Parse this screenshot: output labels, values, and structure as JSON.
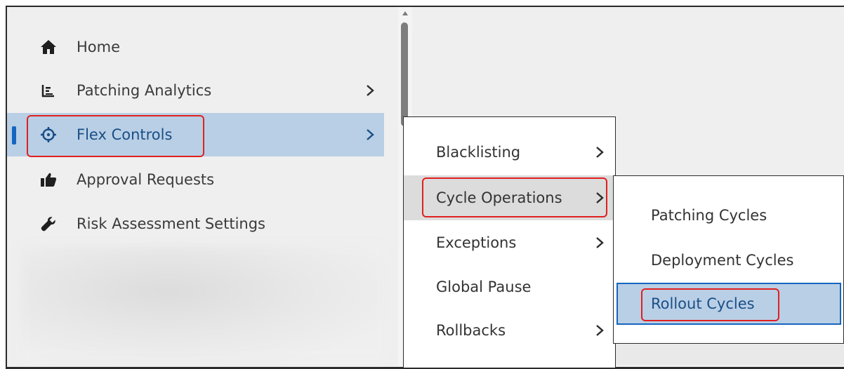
{
  "sidebar": {
    "items": [
      {
        "label": "Home",
        "icon": "home-icon",
        "has_submenu": false
      },
      {
        "label": "Patching Analytics",
        "icon": "analytics-chart-icon",
        "has_submenu": true
      },
      {
        "label": "Flex Controls",
        "icon": "crosshair-icon",
        "has_submenu": true,
        "active": true
      },
      {
        "label": "Approval Requests",
        "icon": "thumbs-up-icon",
        "has_submenu": false
      },
      {
        "label": "Risk Assessment Settings",
        "icon": "wrench-icon",
        "has_submenu": false
      }
    ]
  },
  "flex_submenu": {
    "items": [
      {
        "label": "Blacklisting",
        "has_submenu": true
      },
      {
        "label": "Cycle Operations",
        "has_submenu": true,
        "hovered": true
      },
      {
        "label": "Exceptions",
        "has_submenu": true
      },
      {
        "label": "Global Pause",
        "has_submenu": false
      },
      {
        "label": "Rollbacks",
        "has_submenu": true
      }
    ]
  },
  "cycle_submenu": {
    "items": [
      {
        "label": "Patching Cycles"
      },
      {
        "label": "Deployment Cycles"
      },
      {
        "label": "Rollout Cycles",
        "selected": true
      }
    ]
  },
  "colors": {
    "active_bg": "#b9cfe6",
    "active_text": "#1a4f86",
    "accent": "#1565c0",
    "highlight_box": "#e02020"
  }
}
